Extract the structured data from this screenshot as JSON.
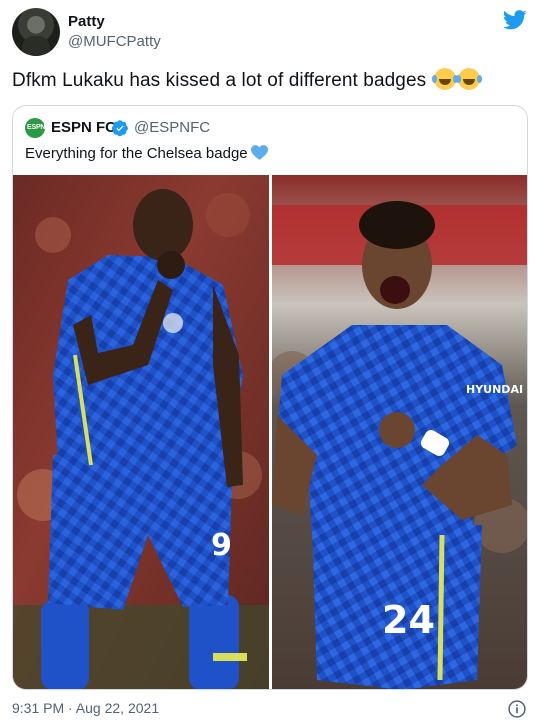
{
  "author": {
    "name": "Patty",
    "handle": "@MUFCPatty"
  },
  "tweet": {
    "text": "Dfkm Lukaku has kissed a lot of different badges",
    "emoji": "face-with-tears-of-joy"
  },
  "quoted_tweet": {
    "name": "ESPN FC",
    "handle": "@ESPNFC",
    "avatar_text": "ESPN",
    "text": "Everything for the Chelsea badge",
    "emoji": "blue-heart",
    "photos": [
      {
        "subject": "player-covering-mouth",
        "shirt_number": "9"
      },
      {
        "subject": "player-celebrating",
        "shirt_number": "24",
        "sponsor": "HYUNDAI"
      }
    ]
  },
  "footer": {
    "timestamp": "9:31 PM · Aug 22, 2021"
  },
  "colors": {
    "twitter_blue": "#1d9bf0",
    "chelsea_blue": "#1a4fc4",
    "text_secondary": "#536471",
    "border": "#cfd9de"
  }
}
